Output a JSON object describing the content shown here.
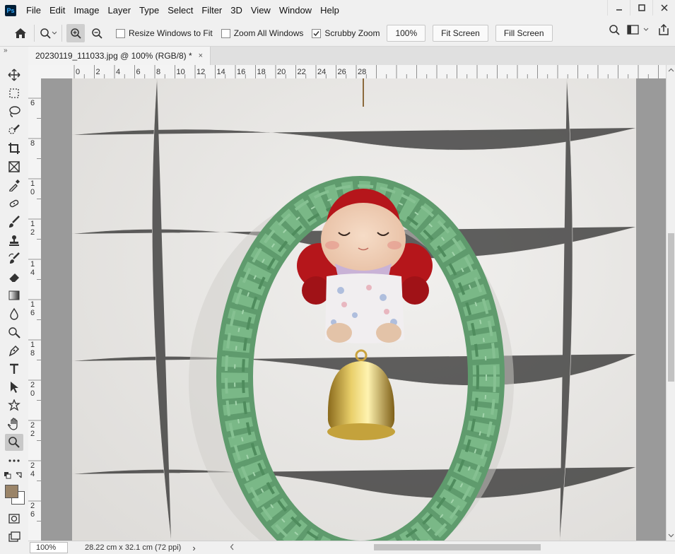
{
  "app": {
    "logo": "Ps"
  },
  "menu": [
    "File",
    "Edit",
    "Image",
    "Layer",
    "Type",
    "Select",
    "Filter",
    "3D",
    "View",
    "Window",
    "Help"
  ],
  "window_controls": [
    "minimize",
    "maximize",
    "close"
  ],
  "options": {
    "resize_windows": {
      "label": "Resize Windows to Fit",
      "checked": false
    },
    "zoom_all": {
      "label": "Zoom All Windows",
      "checked": false
    },
    "scrubby": {
      "label": "Scrubby Zoom",
      "checked": true
    },
    "zoom_value": "100%",
    "fit_screen": "Fit Screen",
    "fill_screen": "Fill Screen"
  },
  "toolbar_collapse": "»",
  "document": {
    "tab_title": "20230119_111033.jpg @ 100% (RGB/8) *",
    "close": "×"
  },
  "ruler": {
    "top": [
      "0",
      "2",
      "4",
      "6",
      "8",
      "10",
      "12",
      "14",
      "16",
      "18",
      "20",
      "22",
      "24",
      "26",
      "28"
    ],
    "left": [
      "6",
      "8",
      "10",
      "12",
      "14",
      "16",
      "18",
      "20",
      "22",
      "24",
      "26"
    ]
  },
  "status": {
    "zoom": "100%",
    "doc_info": "28.22 cm x 32.1 cm (72 ppi)",
    "arrow": "›"
  },
  "colors": {
    "foreground": "#9a8468",
    "background": "#ffffff",
    "canvas_bg": "#9a9a9a",
    "wreath": "#6aa779"
  },
  "tools": [
    "move-icon",
    "marquee-icon",
    "lasso-icon",
    "quick-select-icon",
    "crop-icon",
    "frame-icon",
    "eyedropper-icon",
    "healing-icon",
    "brush-icon",
    "stamp-icon",
    "history-brush-icon",
    "eraser-icon",
    "gradient-icon",
    "blur-icon",
    "dodge-icon",
    "pen-icon",
    "type-icon",
    "path-select-icon",
    "shape-icon",
    "hand-icon",
    "zoom-icon",
    "more-icon"
  ]
}
